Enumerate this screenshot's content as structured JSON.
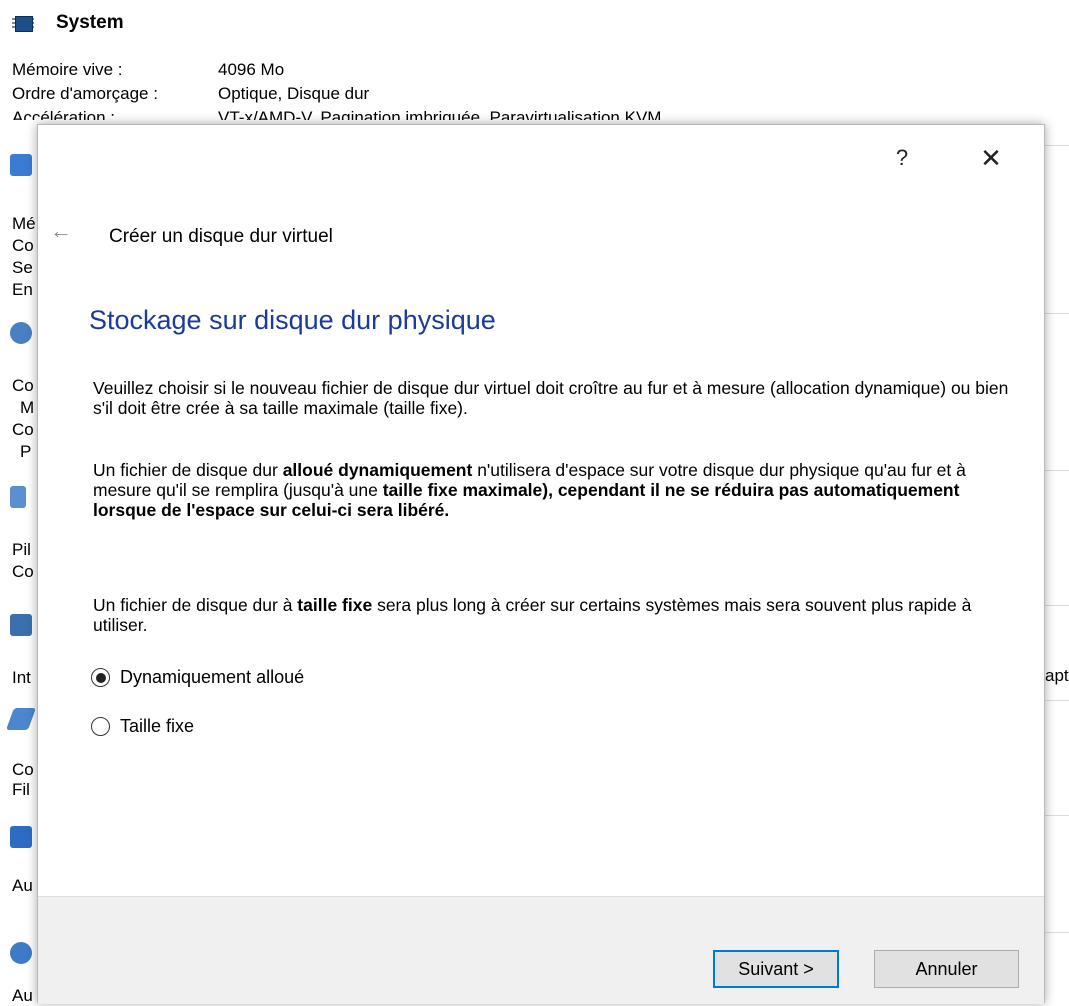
{
  "background": {
    "section_title": "System",
    "rows": [
      {
        "key": "Mémoire vive :",
        "value": "4096 Mo"
      },
      {
        "key": "Ordre d'amorçage :",
        "value": "Optique, Disque dur"
      },
      {
        "key": "Accélération :",
        "value": "VT-x/AMD-V, Pagination imbriquée, Paravirtualisation KVM"
      }
    ],
    "fragments": [
      "Mé",
      "Co",
      "Se",
      "En",
      "Co",
      "M",
      "Co",
      "P",
      "Pil",
      "Co",
      "Int",
      "Co",
      "Fil",
      "Au",
      "Au",
      "apt"
    ]
  },
  "dialog": {
    "help_label": "?",
    "close_label": "✕",
    "back_label": "←",
    "wizard_title": "Créer un disque dur virtuel",
    "heading": "Stockage sur disque dur physique",
    "para1": "Veuillez choisir si le nouveau fichier de disque dur virtuel doit croître au fur et à mesure (allocation dynamique) ou bien s'il doit être crée à sa taille maximale (taille fixe).",
    "para2_a": "Un fichier de disque dur ",
    "para2_b": "alloué dynamiquement",
    "para2_c": " n'utilisera d'espace sur votre disque dur physique qu'au fur et à mesure qu'il se remplira (jusqu'à une ",
    "para2_d": "taille fixe maximale), cependant il ne se réduira pas automatiquement lorsque de l'espace sur celui-ci sera libéré.",
    "para3_a": "Un fichier de disque dur à ",
    "para3_b": "taille fixe",
    "para3_c": " sera plus long à créer sur certains systèmes mais sera souvent plus rapide à utiliser.",
    "options": [
      {
        "label": "Dynamiquement alloué",
        "checked": true
      },
      {
        "label": "Taille fixe",
        "checked": false
      }
    ],
    "next_label": "Suivant >",
    "cancel_label": "Annuler"
  },
  "colors": {
    "heading": "#1c3a9c",
    "focus_border": "#0078d7",
    "footer_bg": "#f0f0f0"
  }
}
